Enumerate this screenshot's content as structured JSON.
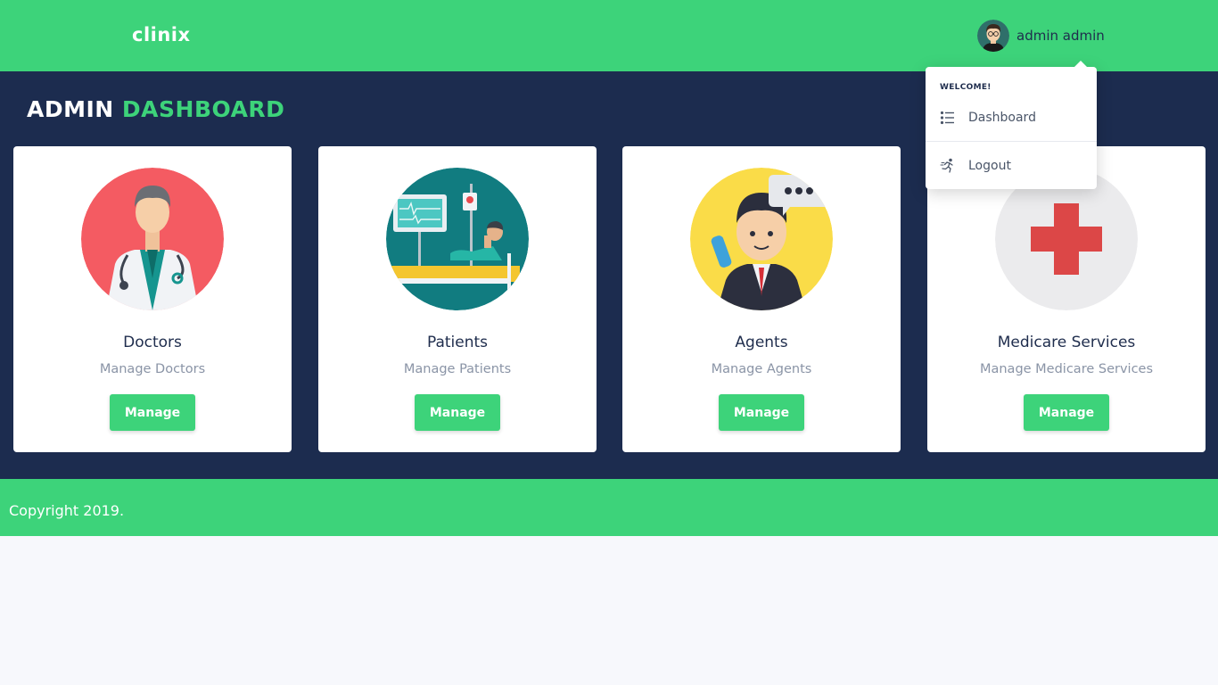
{
  "header": {
    "logo": "clinix",
    "user_name": "admin admin",
    "avatar_icon": "user-avatar"
  },
  "page": {
    "title_main": "ADMIN",
    "title_accent": "DASHBOARD"
  },
  "cards": [
    {
      "title": "Doctors",
      "subtitle": "Manage Doctors",
      "button": "Manage",
      "icon": "doctor-illustration"
    },
    {
      "title": "Patients",
      "subtitle": "Manage Patients",
      "button": "Manage",
      "icon": "patient-bed-illustration"
    },
    {
      "title": "Agents",
      "subtitle": "Manage Agents",
      "button": "Manage",
      "icon": "agent-phone-illustration"
    },
    {
      "title": "Medicare Services",
      "subtitle": "Manage Medicare Services",
      "button": "Manage",
      "icon": "medical-cross-icon"
    }
  ],
  "dropdown": {
    "header": "WELCOME!",
    "items": [
      {
        "label": "Dashboard",
        "icon": "list-icon"
      },
      {
        "label": "Logout",
        "icon": "running-person-icon"
      }
    ]
  },
  "footer": {
    "text": "Copyright 2019."
  },
  "colors": {
    "primary_green": "#3dd37a",
    "navy": "#1c2c4f",
    "background": "#f7f8fc"
  }
}
